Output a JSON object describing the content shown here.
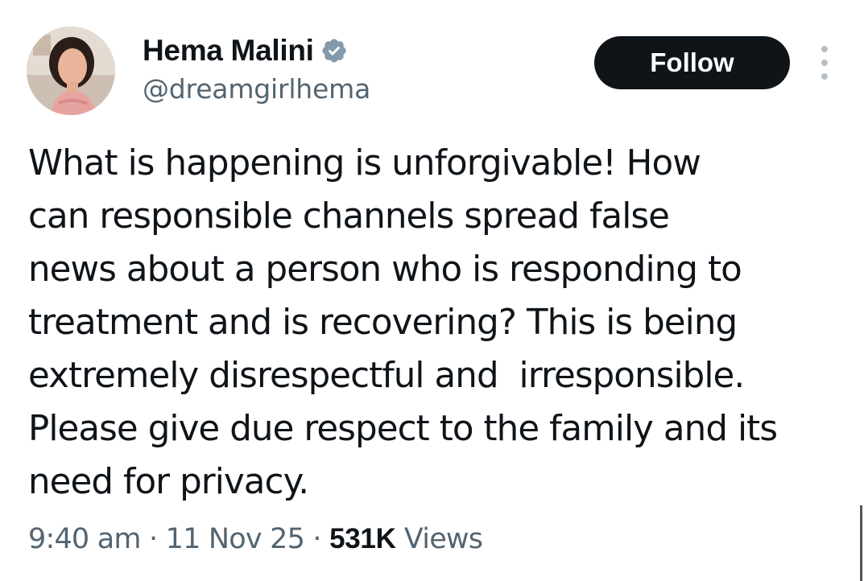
{
  "author": {
    "display_name": "Hema Malini",
    "handle": "@dreamgirlhema",
    "verified": true,
    "avatar": "profile-photo"
  },
  "actions": {
    "follow_label": "Follow",
    "more_icon": "more-vertical-icon"
  },
  "tweet": {
    "lines": [
      "What is happening is unforgivable! How",
      "can responsible channels spread false",
      "news about a person who is responding to",
      "treatment and is recovering? This is being",
      "extremely disrespectful and  irresponsible.",
      "Please give due respect to the family and its",
      "need for privacy."
    ]
  },
  "meta": {
    "time": "9:40 am",
    "separator": "·",
    "date": "11 Nov 25",
    "views_count": "531K",
    "views_label": "Views"
  },
  "colors": {
    "text": "#0f1419",
    "secondary": "#536471",
    "follow_bg": "#0f1419",
    "verified_badge": "#829aab"
  }
}
